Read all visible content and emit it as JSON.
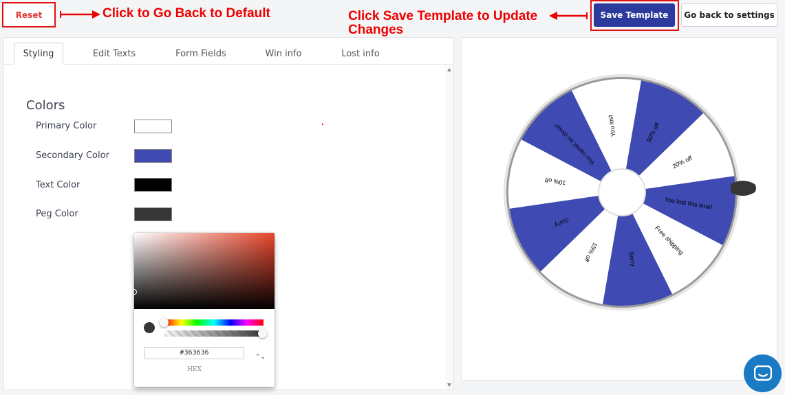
{
  "toolbar": {
    "reset_label": "Reset",
    "save_label": "Save Template",
    "back_label": "Go back to settings"
  },
  "annotations": {
    "reset_hint": "Click to Go Back to Default",
    "save_hint": "Click Save Template to Update Changes"
  },
  "tabs": [
    {
      "label": "Styling",
      "active": true
    },
    {
      "label": "Edit Texts"
    },
    {
      "label": "Form Fields"
    },
    {
      "label": "Win info"
    },
    {
      "label": "Lost info"
    }
  ],
  "colors_section": {
    "title": "Colors",
    "items": [
      {
        "label": "Primary Color",
        "value": "#ffffff"
      },
      {
        "label": "Secondary Color",
        "value": "#3f4ab2"
      },
      {
        "label": "Text Color",
        "value": "#000000"
      },
      {
        "label": "Peg Color",
        "value": "#363636"
      }
    ]
  },
  "picker": {
    "hex_value": "#363636",
    "hex_label": "HEX",
    "toggle_glyph": "⌃⌄"
  },
  "wheel": {
    "primary": "#ffffff",
    "secondary": "#3f4ab2",
    "text_color": "#000000",
    "peg": "#363636",
    "segments": [
      "50% off",
      "20% off",
      "You lost this time!",
      "Free shipping",
      "Sorry",
      "15% off",
      "Sorry",
      "10% off",
      "You came! so close!",
      "You lost"
    ]
  }
}
